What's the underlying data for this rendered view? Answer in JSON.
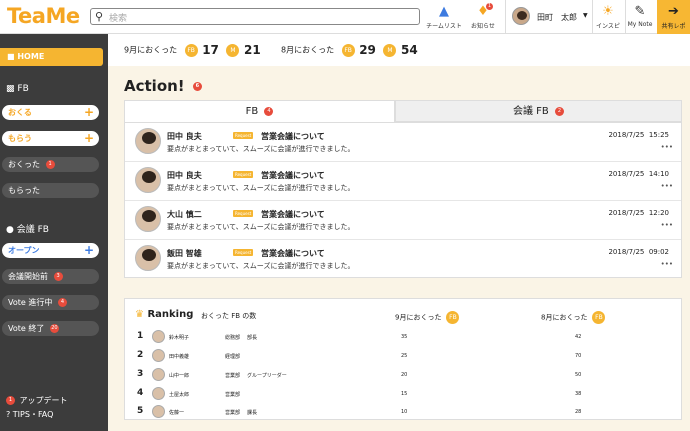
{
  "header": {
    "logo": "TeaMe",
    "search_placeholder": "検索",
    "team_list": "チームリスト",
    "notice": "お知らせ",
    "notice_badge": "1",
    "user_name": "田町　太郎",
    "insight": "インスピ",
    "mynote": "My Note",
    "shared_report": "共有レポ"
  },
  "sidebar": {
    "home": "HOME",
    "fb_section": "FB",
    "send": "おくる",
    "receive": "もらう",
    "sent": "おくった",
    "sent_badge": "1",
    "received": "もらった",
    "meeting_section": "会議 FB",
    "open": "オープン",
    "before_meeting": "会議開始前",
    "before_meeting_badge": "3",
    "vote_ongoing": "Vote 進行中",
    "vote_ongoing_badge": "4",
    "vote_done": "Vote 終了",
    "vote_done_badge": "20",
    "update": "アップデート",
    "update_badge": "1",
    "tips": "TIPS・FAQ"
  },
  "stats": {
    "sep_label": "9月におくった",
    "sep_fb": "17",
    "sep_m": "21",
    "aug_label": "8月におくった",
    "aug_fb": "29",
    "aug_m": "54",
    "fb_coin": "FB",
    "m_coin": "M"
  },
  "action": {
    "title": "Action!",
    "badge": "6",
    "tab_fb": "FB",
    "tab_fb_badge": "4",
    "tab_meeting": "会議 FB",
    "tab_meeting_badge": "2"
  },
  "feed": [
    {
      "name": "田中 良夫",
      "tag": "Request",
      "subject": "営業会議について",
      "date": "2018/7/25",
      "time": "15:25",
      "excerpt": "要点がまとまっていて、スムーズに会議が進行できました。",
      "more": "•••"
    },
    {
      "name": "田中 良夫",
      "tag": "Request",
      "subject": "営業会議について",
      "date": "2018/7/25",
      "time": "14:10",
      "excerpt": "要点がまとまっていて、スムーズに会議が進行できました。",
      "more": "•••"
    },
    {
      "name": "大山 慎二",
      "tag": "Request",
      "subject": "営業会議について",
      "date": "2018/7/25",
      "time": "12:20",
      "excerpt": "要点がまとまっていて、スムーズに会議が進行できました。",
      "more": "•••"
    },
    {
      "name": "飯田 智雄",
      "tag": "Request",
      "subject": "営業会議について",
      "date": "2018/7/25",
      "time": "09:02",
      "excerpt": "要点がまとまっていて、スムーズに会議が進行できました。",
      "more": "•••"
    }
  ],
  "ranking": {
    "title": "Ranking",
    "subtitle": "おくった FB の数",
    "col_sep": "9月におくった",
    "col_aug": "8月におくった",
    "coin": "FB",
    "rows": [
      {
        "rank": "1",
        "name": "鈴木明子",
        "dept": "総務部",
        "role": "部長",
        "sep": "35",
        "aug": "42"
      },
      {
        "rank": "2",
        "name": "田中義雄",
        "dept": "経理部",
        "role": "",
        "sep": "25",
        "aug": "70"
      },
      {
        "rank": "3",
        "name": "山中一郎",
        "dept": "営業部",
        "role": "グループリーダー",
        "sep": "20",
        "aug": "50"
      },
      {
        "rank": "4",
        "name": "土屋太郎",
        "dept": "営業部",
        "role": "",
        "sep": "15",
        "aug": "38"
      },
      {
        "rank": "5",
        "name": "佐藤一",
        "dept": "営業部",
        "role": "課長",
        "sep": "10",
        "aug": "28"
      }
    ]
  }
}
